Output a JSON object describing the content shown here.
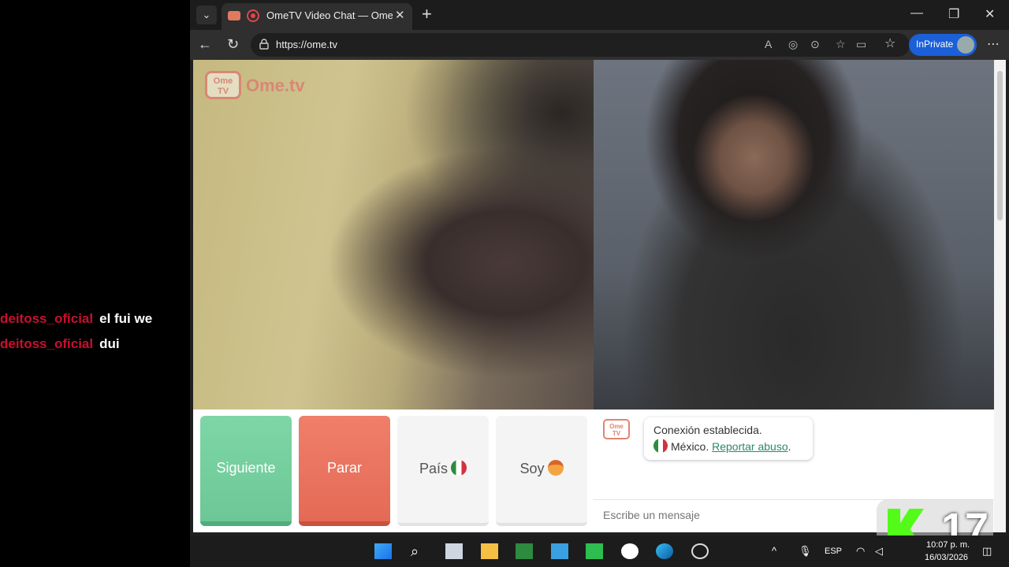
{
  "overlay_chat": [
    {
      "user": "deitoss_oficial",
      "message": "el fui we"
    },
    {
      "user": "deitoss_oficial",
      "message": "dui"
    }
  ],
  "browser": {
    "tab_title": "OmeTV Video Chat — Omegle",
    "url": "https://ome.tv",
    "inprivate_label": "InPrivate"
  },
  "site": {
    "logo_box": "Ome TV",
    "logo_text": "Ome.tv",
    "buttons": {
      "next": "Siguiente",
      "stop": "Parar",
      "country": "País",
      "gender": "Soy"
    },
    "chat": {
      "status": "Conexión establecida.",
      "country": "México.",
      "report_link": "Reportar abuso",
      "input_placeholder": "Escribe un mensaje"
    }
  },
  "sticker": {
    "number": "17"
  },
  "taskbar": {
    "language": "ESP",
    "time": "10:07 p. m.",
    "date": "16/03/2026"
  },
  "colors": {
    "next_button": "#6cc797",
    "stop_button": "#e46a56",
    "brand": "#e08570",
    "inprivate": "#1b5fd9",
    "chat_user": "#c8102e"
  }
}
